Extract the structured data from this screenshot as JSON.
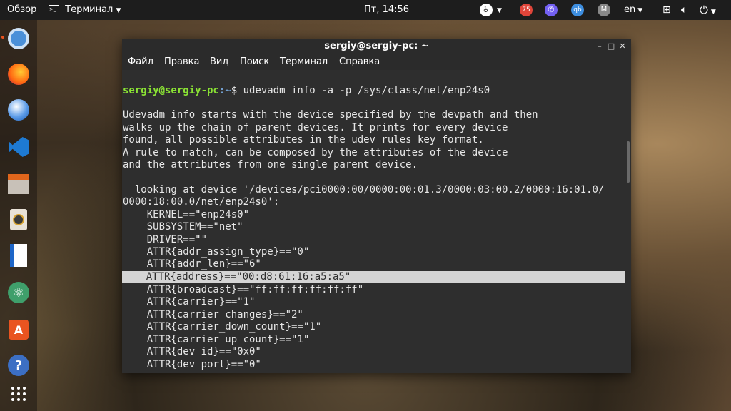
{
  "topbar": {
    "activities": "Обзор",
    "app_menu": "Терминал",
    "clock": "Пт, 14:56",
    "badge_count": "75",
    "language": "en"
  },
  "window": {
    "title": "sergiy@sergiy-pc: ~",
    "menu": [
      "Файл",
      "Правка",
      "Вид",
      "Поиск",
      "Терминал",
      "Справка"
    ]
  },
  "terminal": {
    "prompt_user": "sergiy@sergiy-pc",
    "prompt_path": ":~",
    "prompt_symbol": "$ ",
    "command": "udevadm info -a -p /sys/class/net/enp24s0",
    "output": [
      "Udevadm info starts with the device specified by the devpath and then",
      "walks up the chain of parent devices. It prints for every device",
      "found, all possible attributes in the udev rules key format.",
      "A rule to match, can be composed by the attributes of the device",
      "and the attributes from one single parent device.",
      "",
      "  looking at device '/devices/pci0000:00/0000:00:01.3/0000:03:00.2/0000:16:01.0/",
      "0000:18:00.0/net/enp24s0':",
      "    KERNEL==\"enp24s0\"",
      "    SUBSYSTEM==\"net\"",
      "    DRIVER==\"\"",
      "    ATTR{addr_assign_type}==\"0\"",
      "    ATTR{addr_len}==\"6\"",
      "    ATTR{address}==\"00:d8:61:16:a5:a5\"",
      "    ATTR{broadcast}==\"ff:ff:ff:ff:ff:ff\"",
      "    ATTR{carrier}==\"1\"",
      "    ATTR{carrier_changes}==\"2\"",
      "    ATTR{carrier_down_count}==\"1\"",
      "    ATTR{carrier_up_count}==\"1\"",
      "    ATTR{dev_id}==\"0x0\"",
      "    ATTR{dev_port}==\"0\""
    ]
  },
  "dock": {
    "apps": [
      "chromium-icon",
      "firefox-icon",
      "thunderbird-icon",
      "vscode-icon",
      "files-icon",
      "rhythmbox-icon",
      "writer-icon",
      "atom-icon",
      "software-center-icon",
      "help-icon",
      "show-apps-icon"
    ]
  },
  "colors": {
    "prompt_user": "#8ae234",
    "prompt_path": "#729fcf",
    "terminal_bg": "#2e2e2e",
    "highlight": "#d4d4d4"
  }
}
